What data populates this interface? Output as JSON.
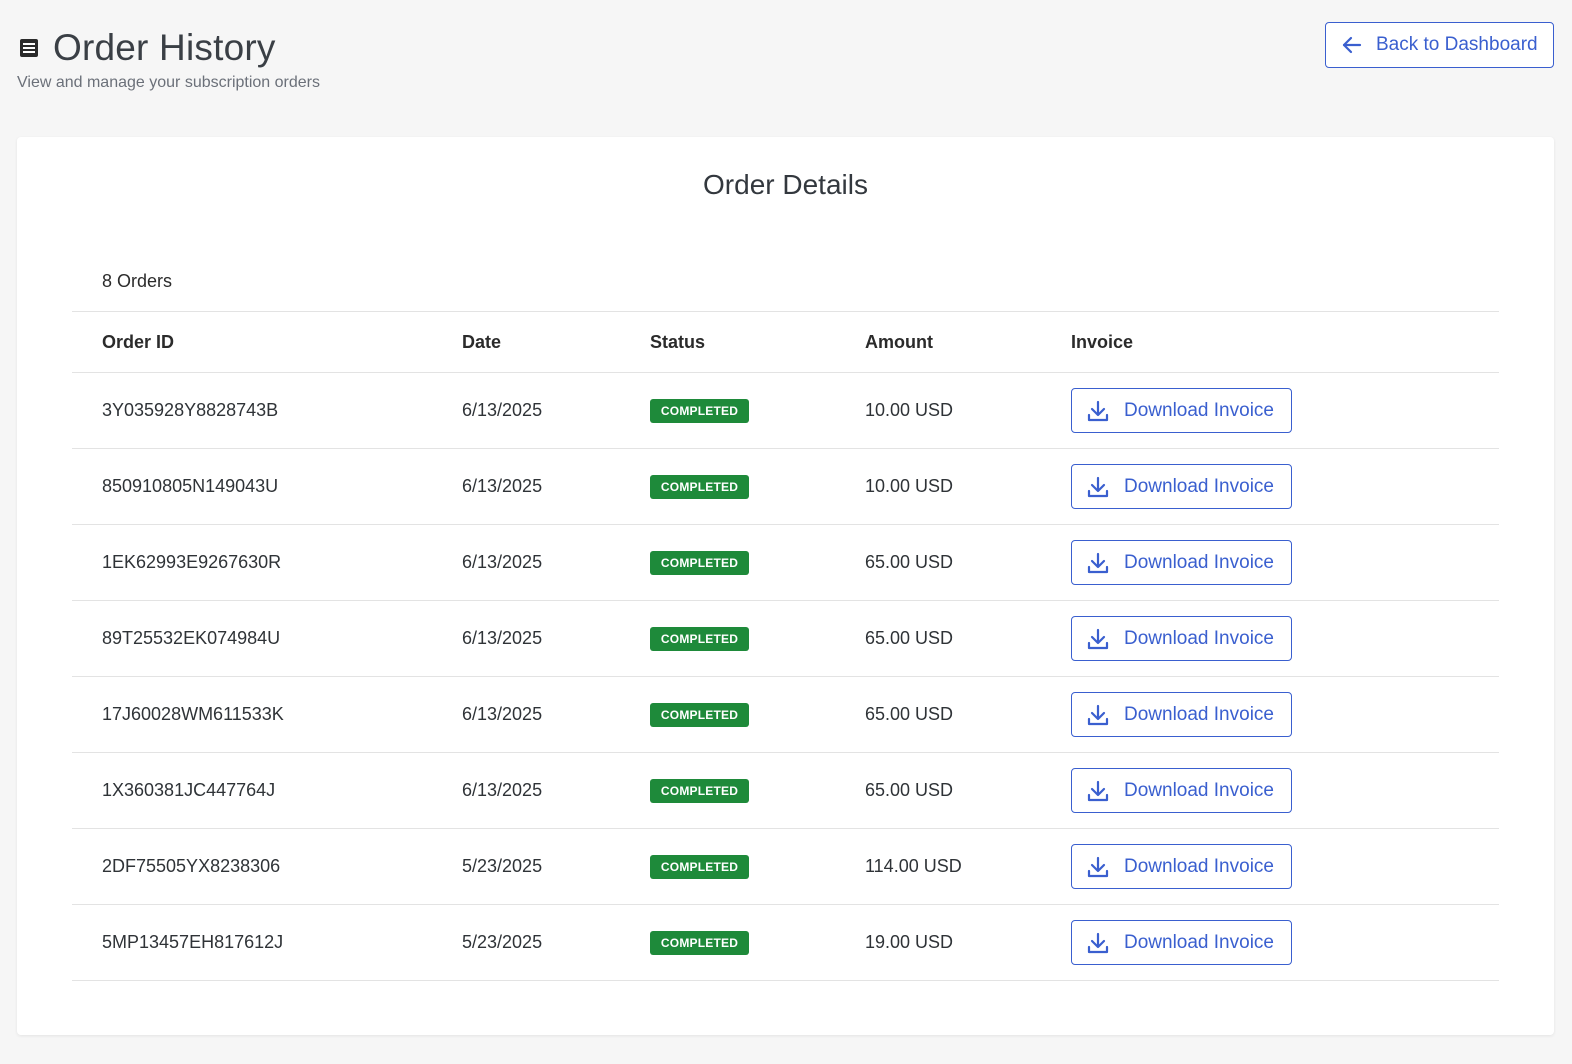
{
  "header": {
    "title": "Order History",
    "subtitle": "View and manage your subscription orders",
    "back_label": "Back to Dashboard"
  },
  "card": {
    "title": "Order Details",
    "count_label": "8 Orders"
  },
  "table": {
    "columns": {
      "order_id": "Order ID",
      "date": "Date",
      "status": "Status",
      "amount": "Amount",
      "invoice": "Invoice"
    },
    "rows": [
      {
        "order_id": "3Y035928Y8828743B",
        "date": "6/13/2025",
        "status": "COMPLETED",
        "amount": "10.00 USD",
        "invoice_label": "Download Invoice"
      },
      {
        "order_id": "850910805N149043U",
        "date": "6/13/2025",
        "status": "COMPLETED",
        "amount": "10.00 USD",
        "invoice_label": "Download Invoice"
      },
      {
        "order_id": "1EK62993E9267630R",
        "date": "6/13/2025",
        "status": "COMPLETED",
        "amount": "65.00 USD",
        "invoice_label": "Download Invoice"
      },
      {
        "order_id": "89T25532EK074984U",
        "date": "6/13/2025",
        "status": "COMPLETED",
        "amount": "65.00 USD",
        "invoice_label": "Download Invoice"
      },
      {
        "order_id": "17J60028WM611533K",
        "date": "6/13/2025",
        "status": "COMPLETED",
        "amount": "65.00 USD",
        "invoice_label": "Download Invoice"
      },
      {
        "order_id": "1X360381JC447764J",
        "date": "6/13/2025",
        "status": "COMPLETED",
        "amount": "65.00 USD",
        "invoice_label": "Download Invoice"
      },
      {
        "order_id": "2DF75505YX8238306",
        "date": "5/23/2025",
        "status": "COMPLETED",
        "amount": "114.00 USD",
        "invoice_label": "Download Invoice"
      },
      {
        "order_id": "5MP13457EH817612J",
        "date": "5/23/2025",
        "status": "COMPLETED",
        "amount": "19.00 USD",
        "invoice_label": "Download Invoice"
      }
    ]
  },
  "icons": {
    "title_icon": "document-list-icon",
    "back_icon": "arrow-left-icon",
    "invoice_icon": "download-icon"
  },
  "colors": {
    "accent": "#3a5fcf",
    "status_completed": "#1e8a3a",
    "page_bg": "#f6f6f6"
  }
}
